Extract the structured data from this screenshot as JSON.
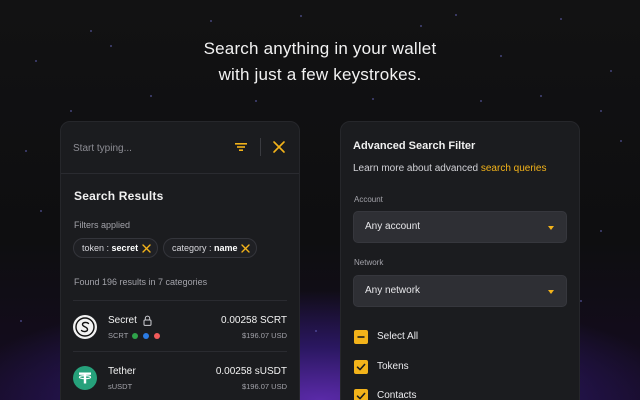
{
  "headline": {
    "line1": "Search anything in your wallet",
    "line2": "with just a few keystrokes."
  },
  "search": {
    "placeholder": "Start typing..."
  },
  "results": {
    "title": "Search Results",
    "filters_label": "Filters applied",
    "chips": [
      {
        "key": "token :",
        "value": "secret"
      },
      {
        "key": "category :",
        "value": "name"
      }
    ],
    "found_text": "Found 196 results in 7 categories",
    "tokens": [
      {
        "name": "Secret",
        "symbol": "SCRT",
        "amount": "0.00258 SCRT",
        "usd": "$196.07 USD",
        "icon": "secret-icon",
        "icon_bg": "#f2f2f2",
        "locked": true,
        "dots": [
          "#2fa34a",
          "#2b7be4",
          "#f25a5a"
        ]
      },
      {
        "name": "Tether",
        "symbol": "sUSDT",
        "amount": "0.00258 sUSDT",
        "usd": "$196.07 USD",
        "icon": "tether-icon",
        "icon_bg": "#26a17b",
        "locked": false,
        "dots": []
      }
    ]
  },
  "advanced": {
    "title": "Advanced Search Filter",
    "learn_prefix": "Learn more about advanced ",
    "learn_link": "search queries",
    "account_label": "Account",
    "account_value": "Any account",
    "network_label": "Network",
    "network_value": "Any network",
    "checkboxes": [
      {
        "label": "Select All",
        "state": "indeterminate"
      },
      {
        "label": "Tokens",
        "state": "checked"
      },
      {
        "label": "Contacts",
        "state": "checked"
      }
    ]
  },
  "colors": {
    "accent": "#f3b31a",
    "panel": "#1b1c1f",
    "background": "#0d0d0e"
  }
}
